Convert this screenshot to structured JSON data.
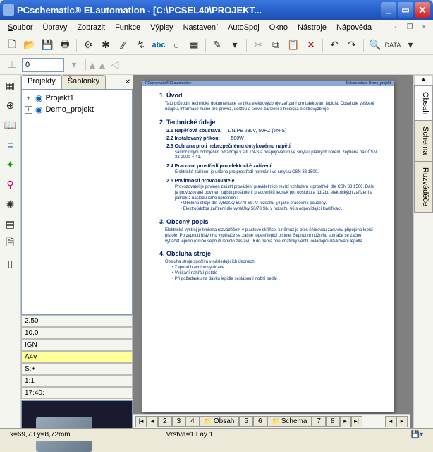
{
  "titlebar": {
    "text": "PCschematic® ELautomation - [C:\\PCSEL40\\PROJEKT..."
  },
  "menu": {
    "soubor": "Soubor",
    "upravy": "Úpravy",
    "zobrazit": "Zobrazit",
    "funkce": "Funkce",
    "vypisy": "Výpisy",
    "nastaveni": "Nastavení",
    "autospoj": "AutoSpoj",
    "okno": "Okno",
    "nastroje": "Nástroje",
    "napoveda": "Nápověda"
  },
  "toolbar2": {
    "combo_value": "0"
  },
  "panel": {
    "tab_projekty": "Projekty",
    "tab_sablonky": "Šablonky",
    "tree_items": [
      "Projekt1",
      "Demo_projekt"
    ]
  },
  "status_cells": {
    "cell1": "2,50",
    "cell2": "10,0",
    "cell3": "IGN",
    "cell4": "A4v",
    "cell5": "S:+",
    "cell6": "1:1",
    "cell7": "17:40:"
  },
  "right_tabs": {
    "t1": "Obsah",
    "t2": "Schema",
    "t3": "Rozváděče"
  },
  "bottom_tabs": {
    "t2": "2",
    "t3": "3",
    "t4": "4",
    "obsah": "Obsah",
    "t5": "5",
    "t6": "6",
    "schema": "Schema",
    "t7": "7",
    "t8": "8"
  },
  "statusbar": {
    "coords": "x=69,73 y=8,72mm",
    "layer": "Vrstva=1:Lay 1"
  },
  "doc": {
    "header_left": "PCschematic® ELautomation",
    "header_right": "Dokumentace Demo_projekt",
    "h1": "1. Úvod",
    "p1": "Tato průvodní technická dokumentace se týká elektrovýzbroje zařízení pro dávkování lepidla. Obsahuje veškeré údaje a informace nutné pro provoz, údržbu a servis zařízení z hlediska elektrovýzbroje.",
    "h2": "2. Technické údaje",
    "s21": "2.1   Napěťová soustava:",
    "s21v": "1/N/PE 230V, 50HZ (TN-S)",
    "s22": "2.2   Instalovaný příkon:",
    "s22v": "500W",
    "s23": "2.3   Ochrana proti nebezpečnému dotykovému napětí",
    "s23b": "samočinným odpojením od zdroje v síti TN-S a pospojováním ve smyslu platných norem, zejména pak ČSN 33 2000-4-41.",
    "s24": "2.4   Pracovní prostředí pro elektrické zařízení",
    "s24b": "Elektrické zařízení je určeno pro prostředí normální ve smyslu ČSN 33 1500.",
    "s25": "2.5   Povinnosti provozovatele",
    "s25b": "Provozovatel je povinen zajistit provádění pravidelných revizí vzhledem k prostředí dle ČSN 33 1500. Dále je provozovatel povinen zajistit proškolení pracovníků jednak pro obsluhu a údržbu elektrických zařízení a jednak z následujícího upřesnění:",
    "s25li1": "Obsluha stroje dle vyhlášky 50/78 Sb. V rozsahu §4 jako pracovník poučený.",
    "s25li2": "Elektroúdržba zařízení dle vyhlášky 50/78 Sb. v rozsahu §6 s odpovídající kvalifikací.",
    "h3": "3. Obecný popis",
    "p3": "Elektrická výstroj je tvořena rozvaděčem v plastové skříňce, k němuž je přes šňůrovou zásuvku připojena lepicí pistole. Po zapnutí hlavního vypínače se začne topení lepicí pistole. Sepnutím nožního spínače se začne vytláčet lepidlo (druhé sepnutí lepidlo zastaví). Kdo nemá pneumatický ventil, ovládající dávkování lepidla.",
    "h4": "4. Obsluha stroje",
    "p4": "Obsluha stroje spočívá v následujících úkonech:",
    "p4li1": "Zapnutí hlavního vypínače",
    "p4li2": "Vyčkání nahřátí pistole",
    "p4li3": "Při požadavku na dávku lepidla sešlápnutí nožní pedál"
  }
}
